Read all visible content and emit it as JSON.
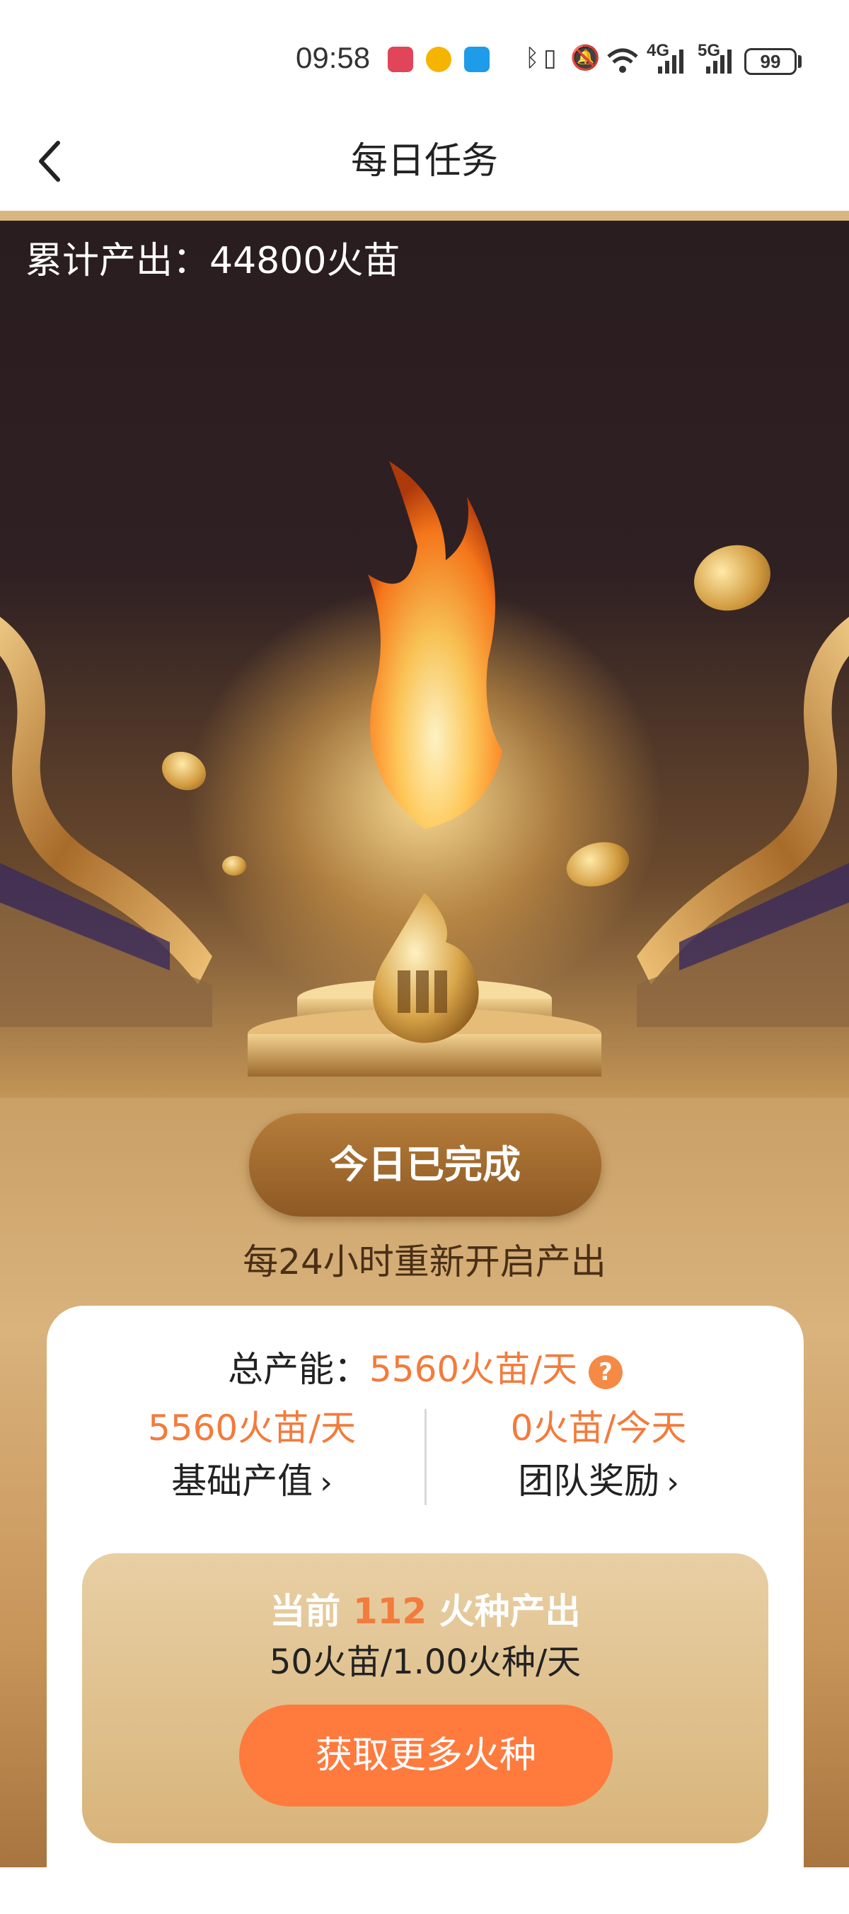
{
  "status_bar": {
    "time": "09:58",
    "network_4g": "4G",
    "network_5g": "5G",
    "battery": "99",
    "icons": [
      "app-red-icon",
      "weibo-icon",
      "app-blue-icon",
      "bluetooth-icon",
      "vibrate-icon",
      "mute-icon",
      "wifi-icon",
      "signal-icon",
      "signal-icon"
    ]
  },
  "nav": {
    "title": "每日任务",
    "back_icon": "chevron-left-icon"
  },
  "hero": {
    "cumulative_output": "累计产出：44800火苗"
  },
  "task": {
    "complete_button": "今日已完成",
    "reset_note": "每24小时重新开启产出"
  },
  "capacity": {
    "total_label": "总产能：",
    "total_value": "5560火苗/天",
    "help_icon": "?",
    "base": {
      "value": "5560火苗/天",
      "label": "基础产值"
    },
    "team": {
      "value": "0火苗/今天",
      "label": "团队奖励"
    }
  },
  "seeds": {
    "prefix": "当前 ",
    "count": "112",
    "suffix": " 火种产出",
    "rate": "50火苗/1.00火种/天",
    "more_button": "获取更多火种"
  },
  "colors": {
    "accent": "#f37b3b",
    "button_orange": "#ff7a3d",
    "gold": "#d8b47a",
    "brown_button": "#9e6a2e"
  }
}
